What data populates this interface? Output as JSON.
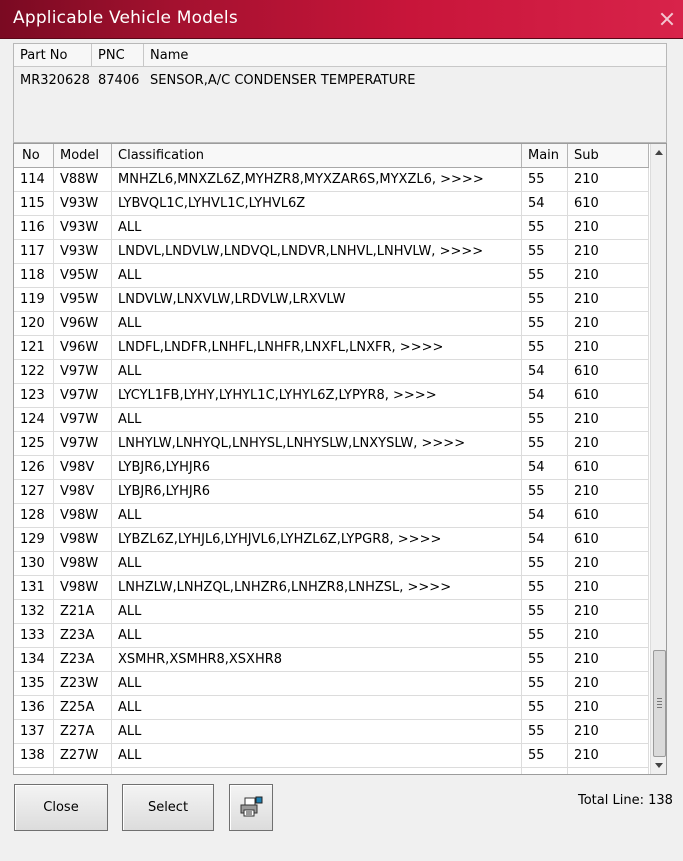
{
  "window": {
    "title": "Applicable Vehicle Models"
  },
  "part": {
    "headers": [
      "Part No",
      "PNC",
      "Name"
    ],
    "part_no": "MR320628",
    "pnc": "87406",
    "name": "SENSOR,A/C CONDENSER TEMPERATURE"
  },
  "table": {
    "headers": [
      "No",
      "Model",
      "Classification",
      "Main",
      "Sub"
    ],
    "rows": [
      [
        "114",
        "V88W",
        "MNHZL6,MNXZL6Z,MYHZR8,MYXZAR6S,MYXZL6,  >>>>",
        "55",
        "210"
      ],
      [
        "115",
        "V93W",
        "LYBVQL1C,LYHVL1C,LYHVL6Z",
        "54",
        "610"
      ],
      [
        "116",
        "V93W",
        "ALL",
        "55",
        "210"
      ],
      [
        "117",
        "V93W",
        "LNDVL,LNDVLW,LNDVQL,LNDVR,LNHVL,LNHVLW,  >>>>",
        "55",
        "210"
      ],
      [
        "118",
        "V95W",
        "ALL",
        "55",
        "210"
      ],
      [
        "119",
        "V95W",
        "LNDVLW,LNXVLW,LRDVLW,LRXVLW",
        "55",
        "210"
      ],
      [
        "120",
        "V96W",
        "ALL",
        "55",
        "210"
      ],
      [
        "121",
        "V96W",
        "LNDFL,LNDFR,LNHFL,LNHFR,LNXFL,LNXFR,  >>>>",
        "55",
        "210"
      ],
      [
        "122",
        "V97W",
        "ALL",
        "54",
        "610"
      ],
      [
        "123",
        "V97W",
        "LYCYL1FB,LYHY,LYHYL1C,LYHYL6Z,LYPYR8,  >>>>",
        "54",
        "610"
      ],
      [
        "124",
        "V97W",
        "ALL",
        "55",
        "210"
      ],
      [
        "125",
        "V97W",
        "LNHYLW,LNHYQL,LNHYSL,LNHYSLW,LNXYSLW,  >>>>",
        "55",
        "210"
      ],
      [
        "126",
        "V98V",
        "LYBJR6,LYHJR6",
        "54",
        "610"
      ],
      [
        "127",
        "V98V",
        "LYBJR6,LYHJR6",
        "55",
        "210"
      ],
      [
        "128",
        "V98W",
        "ALL",
        "54",
        "610"
      ],
      [
        "129",
        "V98W",
        "LYBZL6Z,LYHJL6,LYHJVL6,LYHZL6Z,LYPGR8,  >>>>",
        "54",
        "610"
      ],
      [
        "130",
        "V98W",
        "ALL",
        "55",
        "210"
      ],
      [
        "131",
        "V98W",
        "LNHZLW,LNHZQL,LNHZR6,LNHZR8,LNHZSL,  >>>>",
        "55",
        "210"
      ],
      [
        "132",
        "Z21A",
        "ALL",
        "55",
        "210"
      ],
      [
        "133",
        "Z23A",
        "ALL",
        "55",
        "210"
      ],
      [
        "134",
        "Z23A",
        "XSMHR,XSMHR8,XSXHR8",
        "55",
        "210"
      ],
      [
        "135",
        "Z23W",
        "ALL",
        "55",
        "210"
      ],
      [
        "136",
        "Z25A",
        "ALL",
        "55",
        "210"
      ],
      [
        "137",
        "Z27A",
        "ALL",
        "55",
        "210"
      ],
      [
        "138",
        "Z27W",
        "ALL",
        "55",
        "210"
      ]
    ]
  },
  "buttons": {
    "close": "Close",
    "select": "Select",
    "print_icon": "printer-icon"
  },
  "footer": {
    "total_line": "Total Line: 138"
  },
  "colors": {
    "title_bar": "#c8153a",
    "grid_bg": "#ffffff",
    "window_bg": "#f0f0f0"
  }
}
